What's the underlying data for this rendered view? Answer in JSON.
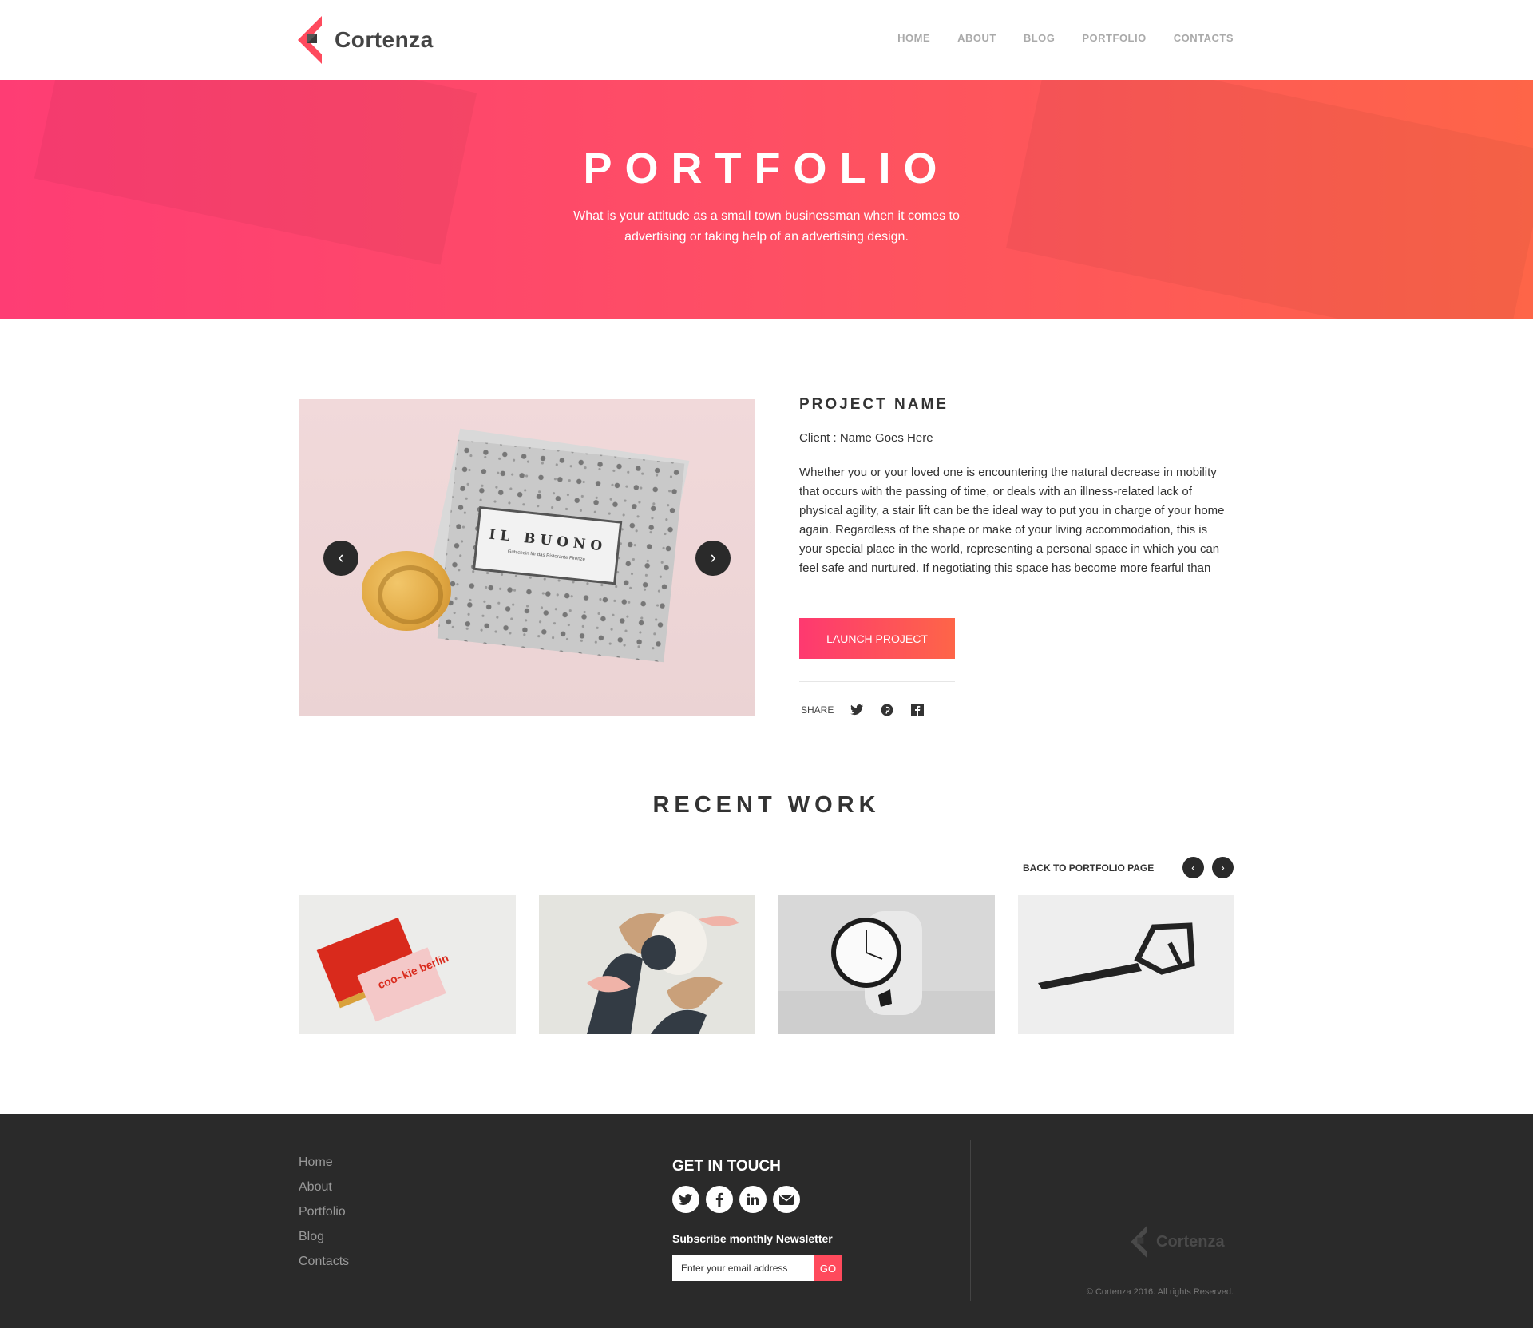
{
  "brand": {
    "name": "Cortenza",
    "accent": "#fe4a5d"
  },
  "nav": [
    "HOME",
    "ABOUT",
    "BLOG",
    "PORTFOLIO",
    "CONTACTS"
  ],
  "hero": {
    "title": "PORTFOLIO",
    "subtitle": "What is your attitude as a small town businessman when it comes to advertising or taking help of an advertising design."
  },
  "project": {
    "slide_card_title": "IL BUONO",
    "slide_card_subtitle": "Gutschein für das Ristorante Firenze",
    "name": "PROJECT NAME",
    "client": "Client : Name Goes Here",
    "description": "Whether you or your loved one is encountering the natural decrease in mobility that occurs with the passing of time, or deals with an illness-related lack of physical agility, a stair lift can be the ideal way to put you in charge of your home again. Regardless of the shape or make of your living accommodation, this is your special place in the world, representing a personal space in which you can feel safe and nurtured. If negotiating this space has become more fearful than",
    "launch_label": "LAUNCH PROJECT",
    "share_label": "SHARE",
    "share_icons": [
      "twitter-icon",
      "pinterest-icon",
      "facebook-icon"
    ]
  },
  "recent": {
    "title": "RECENT WORK",
    "back_label": "BACK TO PORTFOLIO PAGE",
    "thumb_text": "coo–kie berlin"
  },
  "footer": {
    "links": [
      "Home",
      "About",
      "Portfolio",
      "Blog",
      "Contacts"
    ],
    "touch_title": "GET IN TOUCH",
    "touch_icons": [
      "twitter-icon",
      "facebook-icon",
      "linkedin-icon",
      "mail-icon"
    ],
    "newsletter_label": "Subscribe monthly Newsletter",
    "email_placeholder": "Enter your email address",
    "go_label": "GO",
    "logo_text": "Cortenza",
    "copyright": "© Cortenza 2016. All rights Reserved."
  }
}
